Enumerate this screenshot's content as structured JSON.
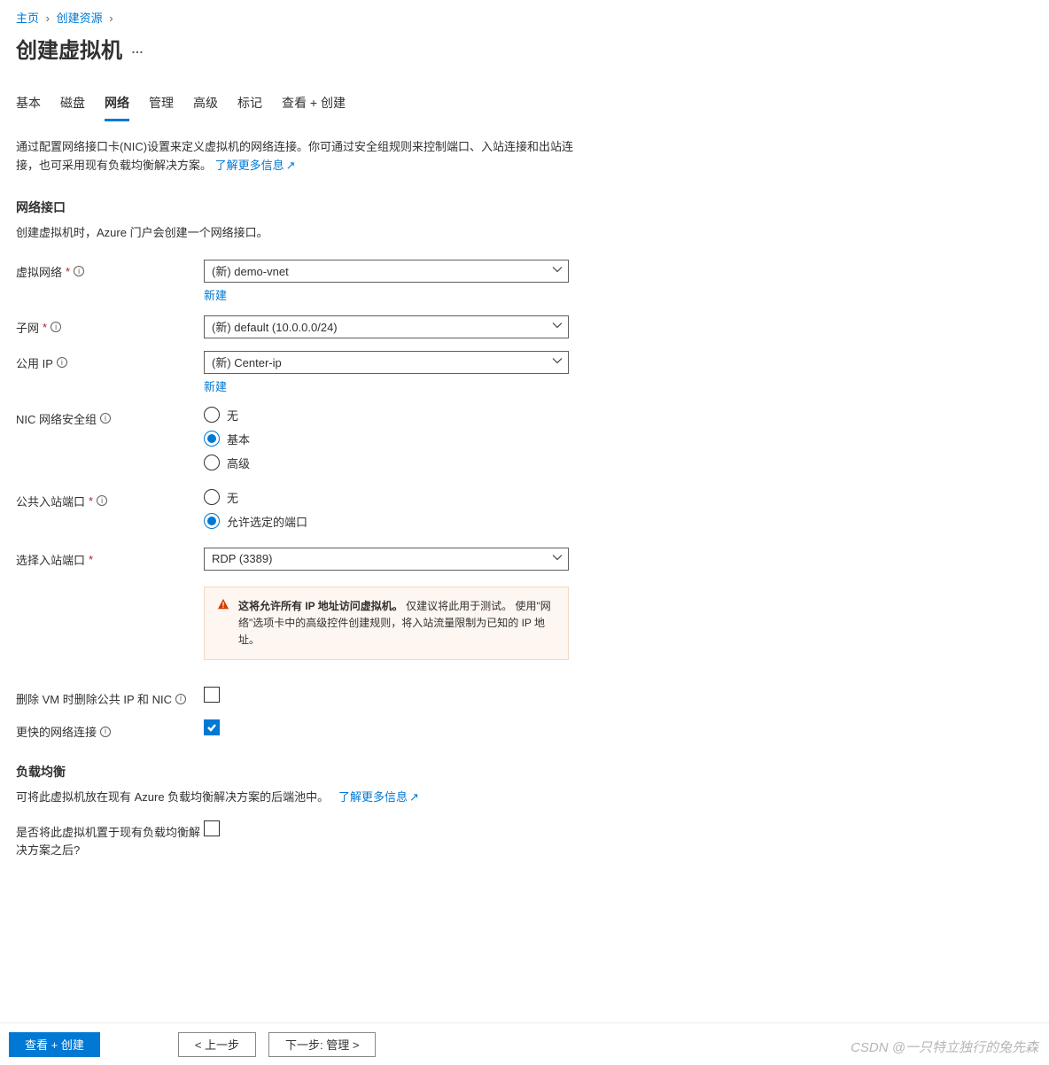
{
  "breadcrumb": {
    "home": "主页",
    "create_resource": "创建资源"
  },
  "page_title": "创建虚拟机",
  "tabs": {
    "basic": "基本",
    "disk": "磁盘",
    "network": "网络",
    "manage": "管理",
    "advanced": "高级",
    "tags": "标记",
    "review": "查看 + 创建"
  },
  "intro": "通过配置网络接口卡(NIC)设置来定义虚拟机的网络连接。你可通过安全组规则来控制端口、入站连接和出站连接，也可采用现有负载均衡解决方案。",
  "learn_more": "了解更多信息",
  "nic_section_title": "网络接口",
  "nic_section_desc": "创建虚拟机时，Azure 门户会创建一个网络接口。",
  "fields": {
    "vnet_label": "虚拟网络",
    "vnet_value": "(新) demo-vnet",
    "vnet_new": "新建",
    "subnet_label": "子网",
    "subnet_value": "(新) default (10.0.0.0/24)",
    "publicip_label": "公用 IP",
    "publicip_value": "(新) Center-ip",
    "publicip_new": "新建",
    "nsg_label": "NIC 网络安全组",
    "nsg_options": {
      "none": "无",
      "basic": "基本",
      "advanced": "高级"
    },
    "inbound_label": "公共入站端口",
    "inbound_options": {
      "none": "无",
      "allow": "允许选定的端口"
    },
    "select_port_label": "选择入站端口",
    "select_port_value": "RDP (3389)",
    "delete_ip_nic_label": "删除 VM 时删除公共 IP 和 NIC",
    "accel_net_label": "更快的网络连接"
  },
  "warning": {
    "bold": "这将允许所有 IP 地址访问虚拟机。",
    "rest": " 仅建议将此用于测试。 使用\"网络\"选项卡中的高级控件创建规则，将入站流量限制为已知的 IP 地址。"
  },
  "lb_section_title": "负载均衡",
  "lb_section_desc": "可将此虚拟机放在现有 Azure 负载均衡解决方案的后端池中。",
  "lb_field_label": "是否将此虚拟机置于现有负载均衡解决方案之后?",
  "footer": {
    "review": "查看 + 创建",
    "prev": "< 上一步",
    "next": "下一步: 管理 >"
  },
  "watermark": "CSDN @一只特立独行的兔先森"
}
